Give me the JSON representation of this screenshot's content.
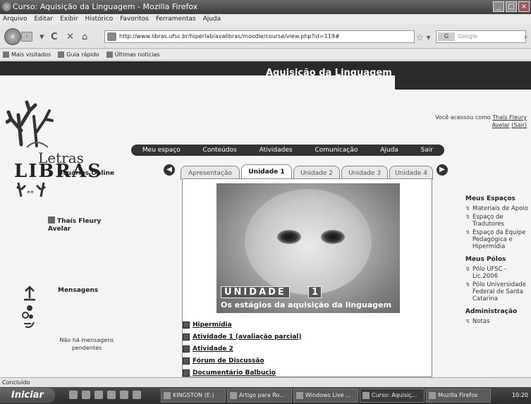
{
  "window": {
    "title": "Curso: Aquisição da Linguagem - Mozilla Firefox"
  },
  "menubar": [
    "Arquivo",
    "Editar",
    "Exibir",
    "Histórico",
    "Favoritos",
    "Ferramentas",
    "Ajuda"
  ],
  "navbar": {
    "url": "http://www.libras.ufsc.br/hiperlab/avalibras/moodle/course/view.php?id=119#",
    "search_placeholder": "Google",
    "search_engine": "G"
  },
  "bookmarks": [
    "Mais visitados",
    "Guia rápido",
    "Últimas notícias"
  ],
  "page": {
    "banner_title": "Aquisição da Linguagem",
    "logo_line1": "Letras",
    "logo_line2": "LIBRAS",
    "access_text": "Você acessou como",
    "access_user": "Thaís Fleury Avelar",
    "access_logout": "(Sair)",
    "topnav": [
      "Meu espaço",
      "Conteúdos",
      "Atividades",
      "Comunicação",
      "Ajuda",
      "Sair"
    ],
    "tabs": [
      "Apresentação",
      "Unidade 1",
      "Unidade 2",
      "Unidade 3",
      "Unidade 4"
    ],
    "active_tab": "Unidade 1",
    "hero_unit": "UNIDADE",
    "hero_unit_number": "1",
    "hero_subtitle": "Os estágios da aquisição da linguagem",
    "links": [
      "Hipermídia",
      "Atividade 1 (avaliação parcial)",
      "Atividade 2",
      "Fórum de Discussão",
      "Documentário Balbucio"
    ],
    "left": {
      "online_title": "Usuários Online",
      "online_user": "Thaís Fleury Avelar",
      "messages_title": "Mensagens",
      "messages_empty": "Não há mensagens pendentes"
    },
    "right": {
      "my_spaces_title": "Meus Espaços",
      "my_spaces": [
        "Materiais de Apoio",
        "Espaço de Tradutores",
        "Espaço da Equipe Pedagógica e Hipermídia"
      ],
      "my_poles_title": "Meus Pólos",
      "my_poles": [
        "Pólo UFSC - Lic.2006",
        "Pólo Universidade Federal de Santa Catarina"
      ],
      "admin_title": "Administração",
      "admin_items": [
        "Notas"
      ]
    }
  },
  "status": "Concluído",
  "taskbar": {
    "start": "Iniciar",
    "items": [
      "KINGSTON (E:)",
      "Artigo para Ro...",
      "Windows Live ...",
      "Curso: Aquisiç...",
      "Mozilla Firefox"
    ],
    "clock": "10:20"
  }
}
